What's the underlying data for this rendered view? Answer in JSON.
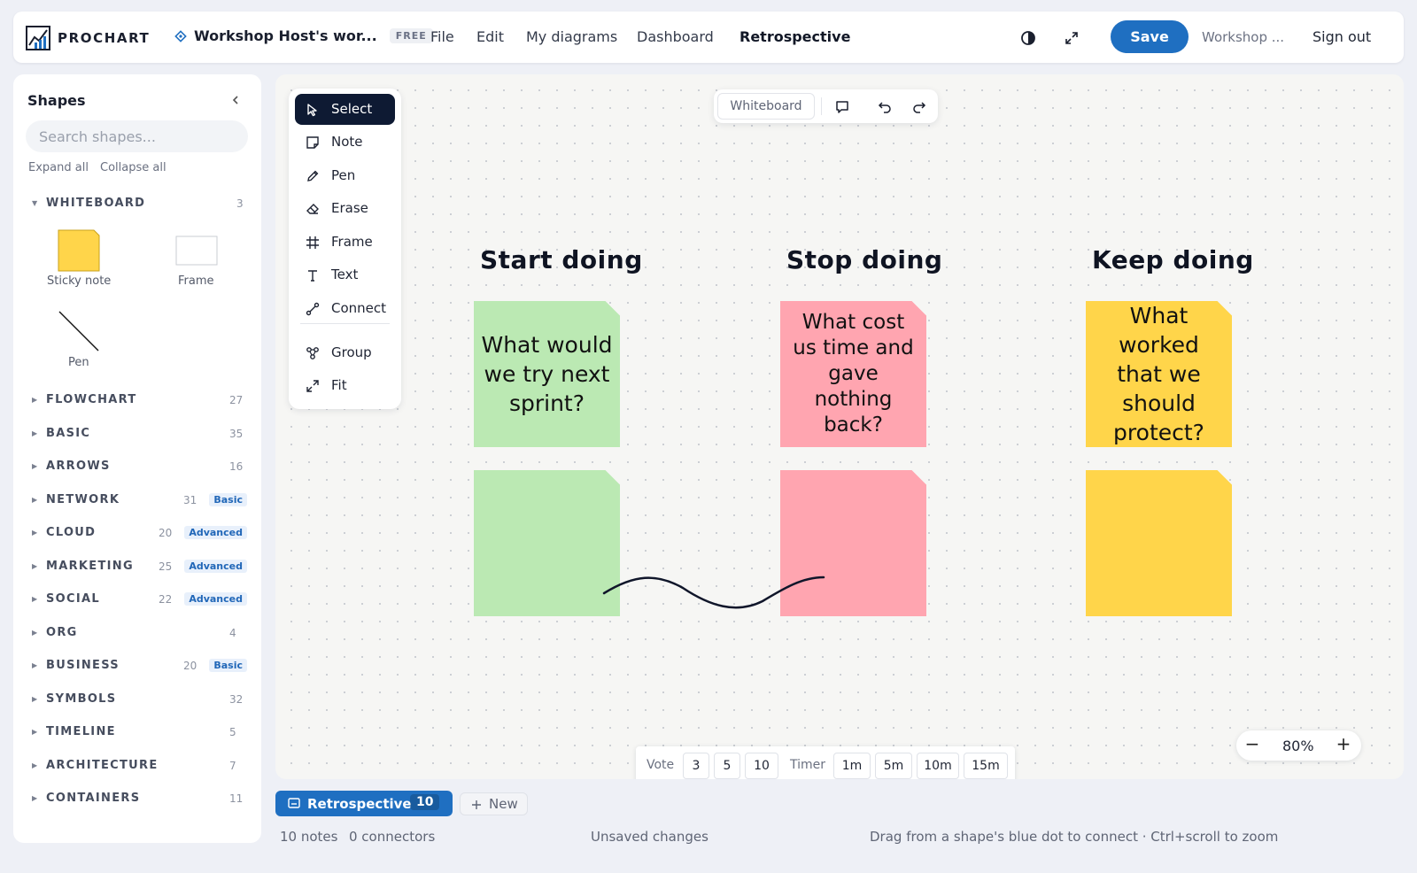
{
  "app": {
    "brand": "PROCHART"
  },
  "header": {
    "workspace_name": "Workshop Host's wor...",
    "plan_badge": "FREE",
    "menu": [
      "File",
      "Edit",
      "My diagrams",
      "Dashboard",
      "Retrospective"
    ],
    "active_menu": "Retrospective",
    "save_label": "Save",
    "user": "Workshop ...",
    "signout_label": "Sign out"
  },
  "sidebar": {
    "title": "Shapes",
    "search_placeholder": "Search shapes...",
    "expand_all": "Expand all",
    "collapse_all": "Collapse all",
    "whiteboard": {
      "name": "WHITEBOARD",
      "count": "3",
      "items": [
        "Sticky note",
        "Frame",
        "Pen"
      ]
    },
    "categories": [
      {
        "name": "FLOWCHART",
        "count": "27",
        "badge": ""
      },
      {
        "name": "BASIC",
        "count": "35",
        "badge": ""
      },
      {
        "name": "ARROWS",
        "count": "16",
        "badge": ""
      },
      {
        "name": "NETWORK",
        "count": "31",
        "badge": "Basic"
      },
      {
        "name": "CLOUD",
        "count": "20",
        "badge": "Advanced"
      },
      {
        "name": "MARKETING",
        "count": "25",
        "badge": "Advanced"
      },
      {
        "name": "SOCIAL",
        "count": "22",
        "badge": "Advanced"
      },
      {
        "name": "ORG",
        "count": "4",
        "badge": ""
      },
      {
        "name": "BUSINESS",
        "count": "20",
        "badge": "Basic"
      },
      {
        "name": "SYMBOLS",
        "count": "32",
        "badge": ""
      },
      {
        "name": "TIMELINE",
        "count": "5",
        "badge": ""
      },
      {
        "name": "ARCHITECTURE",
        "count": "7",
        "badge": ""
      },
      {
        "name": "CONTAINERS",
        "count": "11",
        "badge": ""
      }
    ]
  },
  "tools": {
    "items": [
      "Select",
      "Note",
      "Pen",
      "Erase",
      "Frame",
      "Text",
      "Connect"
    ],
    "extra": [
      "Group",
      "Fit"
    ],
    "active": "Select"
  },
  "floatbar": {
    "mode": "Whiteboard"
  },
  "board": {
    "columns": [
      {
        "title": "Start doing",
        "prompt": "What would we try next sprint?",
        "color": "#bbe9b3"
      },
      {
        "title": "Stop doing",
        "prompt": "What cost us time and gave nothing back?",
        "color": "#ffa5b0"
      },
      {
        "title": "Keep doing",
        "prompt": "What worked that we should protect?",
        "color": "#ffd54a"
      }
    ]
  },
  "votebar": {
    "vote_label": "Vote",
    "votes": [
      "3",
      "5",
      "10"
    ],
    "timer_label": "Timer",
    "timers": [
      "1m",
      "5m",
      "10m",
      "15m"
    ]
  },
  "zoom": {
    "minus": "−",
    "value": "80%",
    "plus": "+"
  },
  "tabs": {
    "active": {
      "label": "Retrospective",
      "count": "10"
    },
    "new_label": "New"
  },
  "status": {
    "notes": "10 notes",
    "connectors": "0 connectors",
    "saved": "Unsaved changes",
    "hint": "Drag from a shape's blue dot to connect · Ctrl+scroll to zoom"
  }
}
